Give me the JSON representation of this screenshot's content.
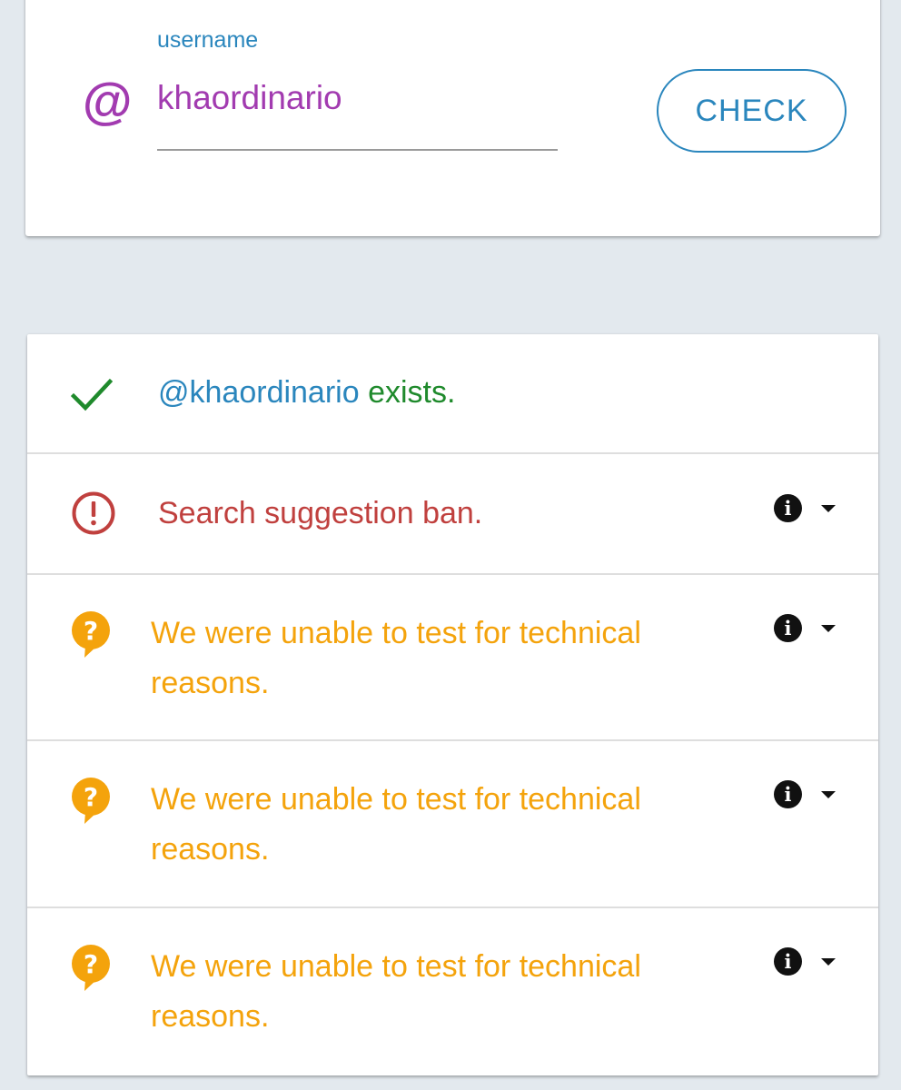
{
  "search": {
    "label": "username",
    "at_symbol": "@",
    "value": "khaordinario",
    "button_label": "CHECK"
  },
  "results": [
    {
      "status": "ok",
      "icon": "checkmark-icon",
      "handle": "@khaordinario",
      "text": "exists.",
      "has_info": false
    },
    {
      "status": "ban",
      "icon": "alert-circle-icon",
      "text": "Search suggestion ban.",
      "has_info": true
    },
    {
      "status": "unknown",
      "icon": "question-bubble-icon",
      "line1": "We were unable to test for technical",
      "line2": "reasons.",
      "has_info": true
    },
    {
      "status": "unknown",
      "icon": "question-bubble-icon",
      "line1": "We were unable to test for technical",
      "line2": "reasons.",
      "has_info": true
    },
    {
      "status": "unknown",
      "icon": "question-bubble-icon",
      "line1": "We were unable to test for technical",
      "line2": "reasons.",
      "has_info": true
    }
  ],
  "info_glyph": "i",
  "colors": {
    "accent_blue": "#2a86bd",
    "purple": "#a23bb0",
    "success_green": "#1f8a2c",
    "error_red": "#c0403e",
    "warning_orange": "#f4a30c",
    "background": "#e3e9ee"
  }
}
